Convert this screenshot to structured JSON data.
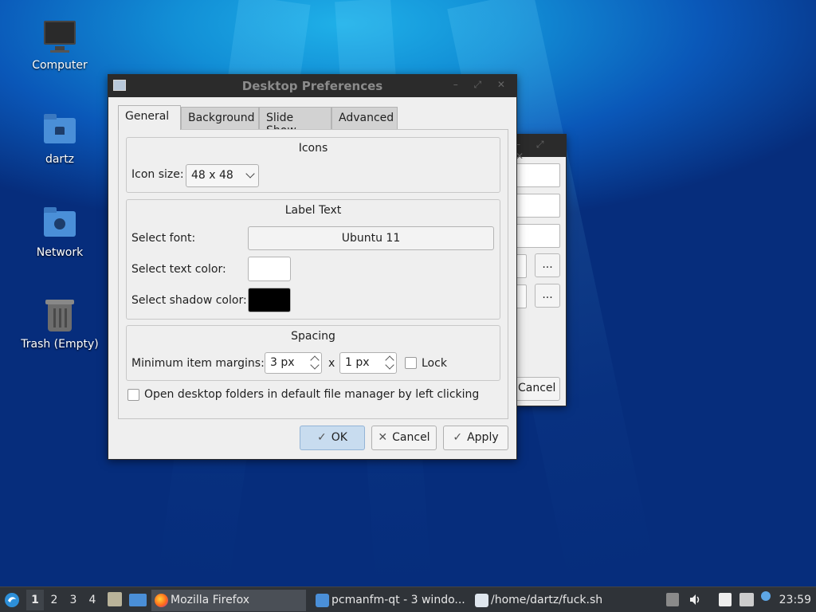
{
  "desktop": {
    "icons": [
      {
        "label": "Computer"
      },
      {
        "label": "dartz"
      },
      {
        "label": "Network"
      },
      {
        "label": "Trash (Empty)"
      }
    ]
  },
  "background_window": {
    "dots_label": "...",
    "cancel_label": "Cancel"
  },
  "dialog": {
    "title": "Desktop Preferences",
    "tabs": [
      {
        "label": "General",
        "active": true
      },
      {
        "label": "Background",
        "active": false
      },
      {
        "label": "Slide Show",
        "active": false
      },
      {
        "label": "Advanced",
        "active": false
      }
    ],
    "icons_group": {
      "title": "Icons",
      "icon_size_label": "Icon size:",
      "icon_size_value": "48 x 48"
    },
    "label_text_group": {
      "title": "Label Text",
      "font_label": "Select font:",
      "font_value": "Ubuntu 11",
      "text_color_label": "Select text color:",
      "text_color": "#ffffff",
      "shadow_color_label": "Select shadow color:",
      "shadow_color": "#000000"
    },
    "spacing_group": {
      "title": "Spacing",
      "margins_label": "Minimum item margins:",
      "margin_x": "3 px",
      "separator": "x",
      "margin_y": "1 px",
      "lock_label": "Lock",
      "lock_checked": false
    },
    "open_folders_label": "Open desktop folders in default file manager by left clicking",
    "open_folders_checked": false,
    "buttons": {
      "ok": "OK",
      "cancel": "Cancel",
      "apply": "Apply"
    }
  },
  "taskbar": {
    "desktops": [
      "1",
      "2",
      "3",
      "4"
    ],
    "current_desktop": "1",
    "tasks": [
      {
        "label": "Mozilla Firefox",
        "icon": "firefox-icon",
        "active": true
      },
      {
        "label": "pcmanfm-qt - 3 windo...",
        "icon": "folder-icon",
        "active": false
      },
      {
        "label": "/home/dartz/fuck.sh",
        "icon": "text-editor-icon",
        "active": false
      }
    ],
    "clock": "23:59"
  },
  "colors": {
    "accent": "#c8dcef",
    "titlebar": "#2b2b2b",
    "taskbar": "#2f3338"
  }
}
